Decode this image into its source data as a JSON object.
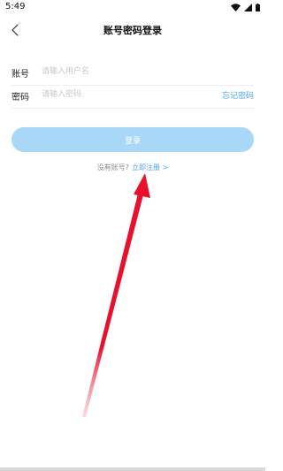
{
  "status_bar": {
    "time": "5:49"
  },
  "header": {
    "title": "账号密码登录",
    "back_icon": "chevron-left-icon"
  },
  "form": {
    "account": {
      "label": "账号",
      "placeholder": "请输入用户名"
    },
    "password": {
      "label": "密码",
      "placeholder": "请输入密码",
      "forgot_label": "忘记密码"
    },
    "login_button": "登录"
  },
  "register": {
    "prompt": "没有账号?",
    "link": "立即注册 >"
  },
  "colors": {
    "accent": "#4ea6f0",
    "button_disabled": "#a9d7f8",
    "annotation_arrow": "#e8112d"
  }
}
